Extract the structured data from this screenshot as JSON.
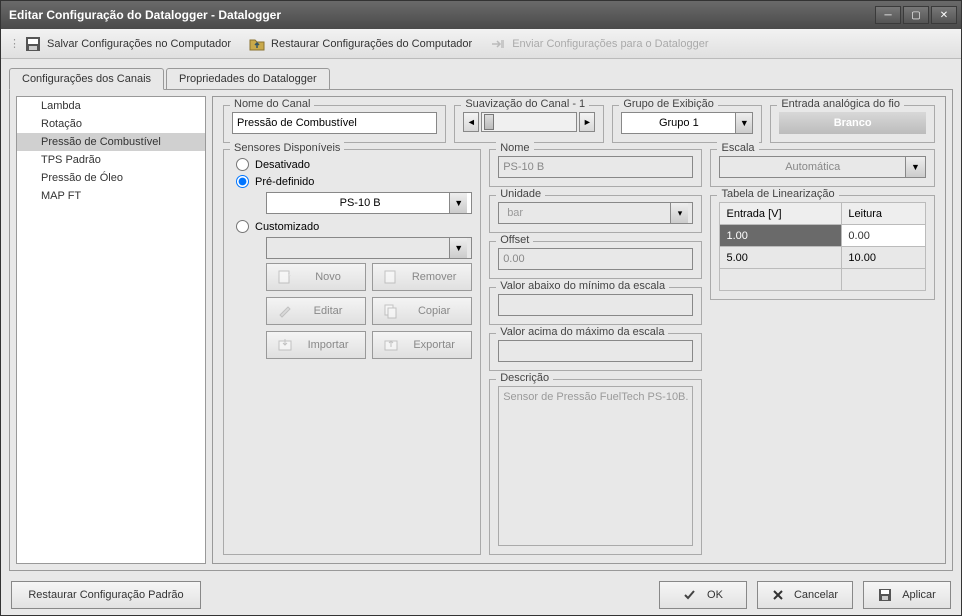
{
  "title": "Editar Configuração do Datalogger - Datalogger",
  "toolbar": {
    "save": "Salvar Configurações no Computador",
    "restore": "Restaurar Configurações do Computador",
    "send": "Enviar Configurações para o Datalogger"
  },
  "tabs": {
    "channels": "Configurações dos Canais",
    "properties": "Propriedades do Datalogger"
  },
  "channels_list": [
    "Lambda",
    "Rotação",
    "Pressão de Combustível",
    "TPS Padrão",
    "Pressão de Óleo",
    "MAP FT"
  ],
  "channel_selected_index": 2,
  "labels": {
    "nome_canal": "Nome do Canal",
    "suavizacao": "Suavização do Canal - 1",
    "grupo_exibicao": "Grupo de Exibição",
    "entrada_analogica": "Entrada analógica do fio",
    "sensores": "Sensores Disponíveis",
    "desativado": "Desativado",
    "predefinido": "Pré-definido",
    "customizado": "Customizado",
    "novo": "Novo",
    "remover": "Remover",
    "editar": "Editar",
    "copiar": "Copiar",
    "importar": "Importar",
    "exportar": "Exportar",
    "nome": "Nome",
    "unidade": "Unidade",
    "offset": "Offset",
    "valor_abaixo": "Valor abaixo do mínimo da escala",
    "valor_acima": "Valor acima do máximo da escala",
    "descricao": "Descrição",
    "escala": "Escala",
    "tabela_lin": "Tabela de Linearização",
    "col_entrada": "Entrada [V]",
    "col_leitura": "Leitura"
  },
  "values": {
    "nome_canal": "Pressão de Combustível",
    "grupo": "Grupo 1",
    "wire_color": "Branco",
    "predefinido_value": "PS-10 B",
    "nome_sensor": "PS-10 B",
    "unidade": "bar",
    "offset": "0.00",
    "descricao": "Sensor de Pressão FuelTech PS-10B.",
    "escala": "Automática"
  },
  "lin_table": [
    {
      "entrada": "1.00",
      "leitura": "0.00"
    },
    {
      "entrada": "5.00",
      "leitura": "10.00"
    }
  ],
  "buttons": {
    "restore_default": "Restaurar Configuração Padrão",
    "ok": "OK",
    "cancel": "Cancelar",
    "apply": "Aplicar"
  }
}
